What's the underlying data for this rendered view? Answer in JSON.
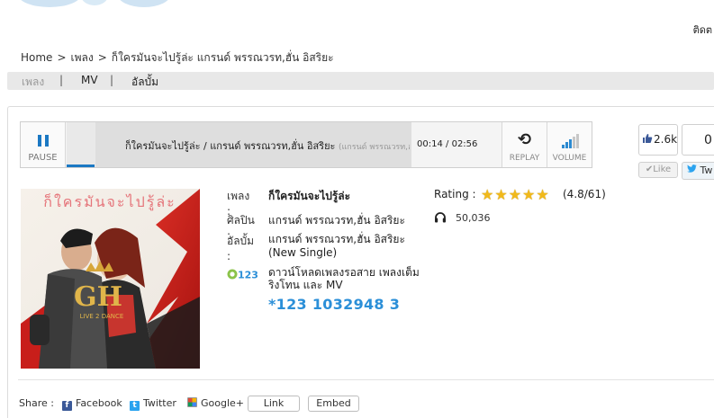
{
  "header": {
    "contact_link": "ติดต"
  },
  "breadcrumb": {
    "items": [
      "Home",
      "เพลง",
      "ก็ใครมันจะไปรู้ล่ะ แกรนด์ พรรณวรท,ฮั่น อิสริยะ"
    ],
    "separator": ">"
  },
  "subnav": {
    "items": [
      "เพลง",
      "MV",
      "อัลบั้ม"
    ],
    "active": "เพลง",
    "divider": "|"
  },
  "player": {
    "pause_label": "PAUSE",
    "track_title": "ก็ใครมันจะไปรู้ล่ะ / แกรนด์ พรรณวรท,ฮั่น อิสริยะ",
    "track_subtitle": "(แกรนด์ พรรณวรท,ฮั",
    "time_current": "00:14",
    "time_total": "02:56",
    "time_separator": "/",
    "progress": 0.08,
    "replay_label": "REPLAY",
    "volume_label": "VOLUME",
    "volume_level": 0.6,
    "colors": {
      "accent": "#1b78c3"
    }
  },
  "social": {
    "like_count": "2.6k",
    "like_button": "Like",
    "tweet_count": "0",
    "tweet_button": "Tw"
  },
  "song": {
    "labels": {
      "song": "เพลง :",
      "artist": "ศิลปิน :",
      "album": "อัลบั้ม :"
    },
    "title": "ก็ใครมันจะไปรู้ล่ะ",
    "artist": "แกรนด์ พรรณวรท,ฮั่น อิสริยะ",
    "album_line1": "แกรนด์ พรรณวรท,ฮั่น อิสริยะ",
    "album_line2": "(New Single)",
    "cover_text": "ก็ใครมันจะไปรู้ล่ะ",
    "cover_logo": "GH",
    "cover_tagline": "LIVE 2 DANCE"
  },
  "promo": {
    "badge": "123",
    "line1": "ดาวน์โหลดเพลงรอสาย เพลงเต็ม",
    "line2": "ริงโทน และ MV",
    "code": "*123 1032948 3"
  },
  "rating": {
    "label": "Rating :",
    "stars": 5,
    "score_text": "(4.8/61)",
    "listens": "50,036"
  },
  "share": {
    "label": "Share :",
    "facebook": "Facebook",
    "twitter": "Twitter",
    "googleplus": "Google+",
    "link_button": "Link",
    "embed_button": "Embed"
  }
}
